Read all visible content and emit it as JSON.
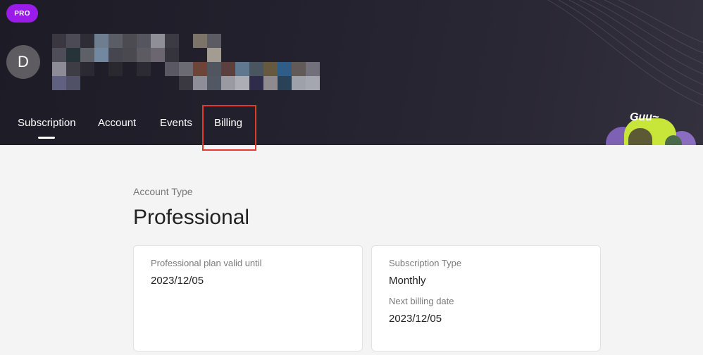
{
  "header": {
    "badge": "PRO",
    "avatar_initial": "D",
    "tabs": [
      {
        "label": "Subscription",
        "active": true
      },
      {
        "label": "Account",
        "active": false
      },
      {
        "label": "Events",
        "active": false
      },
      {
        "label": "Billing",
        "active": false
      }
    ],
    "mascot_text": "Guu~"
  },
  "account": {
    "type_label": "Account Type",
    "type_value": "Professional"
  },
  "cards": {
    "plan": {
      "label": "Professional plan valid until",
      "value": "2023/12/05"
    },
    "subscription": {
      "type_label": "Subscription Type",
      "type_value": "Monthly",
      "next_label": "Next billing date",
      "next_value": "2023/12/05"
    }
  },
  "colors": {
    "badge": "#9b1ce8",
    "header_bg": "#1f1d28",
    "highlight": "#e53a2b",
    "mascot": "#c8e63a"
  }
}
